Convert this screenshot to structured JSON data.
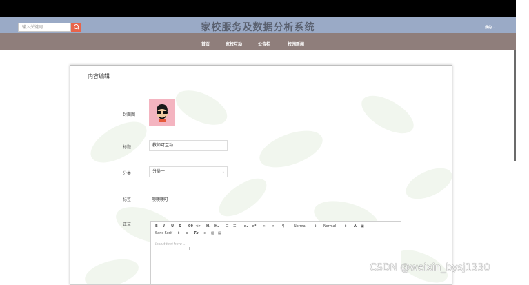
{
  "header": {
    "search_placeholder": "输入关键词",
    "site_title": "家校服务及数据分析系统",
    "user_menu": "我的 ⌄"
  },
  "nav": {
    "items": [
      "首页",
      "家校互动",
      "公告栏",
      "校园新闻"
    ]
  },
  "form": {
    "heading": "内容编辑",
    "cover_label": "封面图",
    "title_label": "标题",
    "title_value": "教师可互动",
    "category_label": "分类",
    "category_value": "分类一",
    "tags_label": "标签",
    "tags_value": "噢噢噢叮",
    "body_label": "正文",
    "editor_placeholder": "Insert text here ..."
  },
  "toolbar": {
    "bold": "B",
    "italic": "I",
    "underline": "U",
    "strike": "S",
    "quote": "99",
    "code": "<>",
    "h1": "H₁",
    "h2": "H₂",
    "ol": "☰",
    "ul": "☰",
    "sub": "x₁",
    "sup": "x²",
    "outdent": "⇤",
    "indent": "⇥",
    "rtl": "¶",
    "size": "Normal",
    "header": "Normal",
    "color": "A",
    "background": "▣",
    "font": "Sans Serif",
    "align": "≡",
    "clean": "Tx",
    "link": "🔗",
    "image": "▧",
    "video": "▤"
  },
  "watermark": "CSDN @weixin_bysj1330"
}
